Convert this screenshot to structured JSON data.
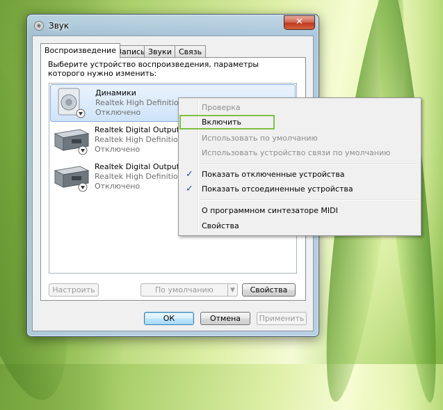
{
  "window": {
    "title": "Звук",
    "close_label": "✕"
  },
  "tabs": [
    {
      "label": "Воспроизведение",
      "active": true
    },
    {
      "label": "Запись",
      "active": false
    },
    {
      "label": "Звуки",
      "active": false
    },
    {
      "label": "Связь",
      "active": false
    }
  ],
  "instruction": "Выберите устройство воспроизведения, параметры которого нужно изменить:",
  "devices": [
    {
      "name": "Динамики",
      "description": "Realtek High Definition",
      "status": "Отключено",
      "icon": "speaker-icon",
      "selected": true
    },
    {
      "name": "Realtek Digital Output",
      "description": "Realtek High Definition",
      "status": "Отключено",
      "icon": "digital-output-icon",
      "selected": false
    },
    {
      "name": "Realtek Digital Output",
      "description": "Realtek High Definition",
      "status": "Отключено",
      "icon": "digital-output-icon",
      "selected": false
    }
  ],
  "panel_buttons": {
    "configure": "Настроить",
    "set_default": "По умолчанию",
    "properties": "Свойства"
  },
  "dialog_buttons": {
    "ok": "ОК",
    "cancel": "Отмена",
    "apply": "Применить"
  },
  "context_menu": {
    "items": [
      {
        "label": "Проверка",
        "enabled": false
      },
      {
        "label": "Включить",
        "enabled": true,
        "highlighted": true
      },
      {
        "label": "Использовать по умолчанию",
        "enabled": false
      },
      {
        "label": "Использовать устройство связи по умолчанию",
        "enabled": false
      },
      {
        "label": "Показать отключенные устройства",
        "enabled": true,
        "checked": true
      },
      {
        "label": "Показать отсоединенные устройства",
        "enabled": true,
        "checked": true
      },
      {
        "label": "О программном синтезаторе MIDI",
        "enabled": true
      },
      {
        "label": "Свойства",
        "enabled": true
      }
    ],
    "check_glyph": "✓"
  },
  "colors": {
    "highlight_box": "#7ec042",
    "selection": "#cfe3f8",
    "disabled_text": "#8d8d8d"
  }
}
